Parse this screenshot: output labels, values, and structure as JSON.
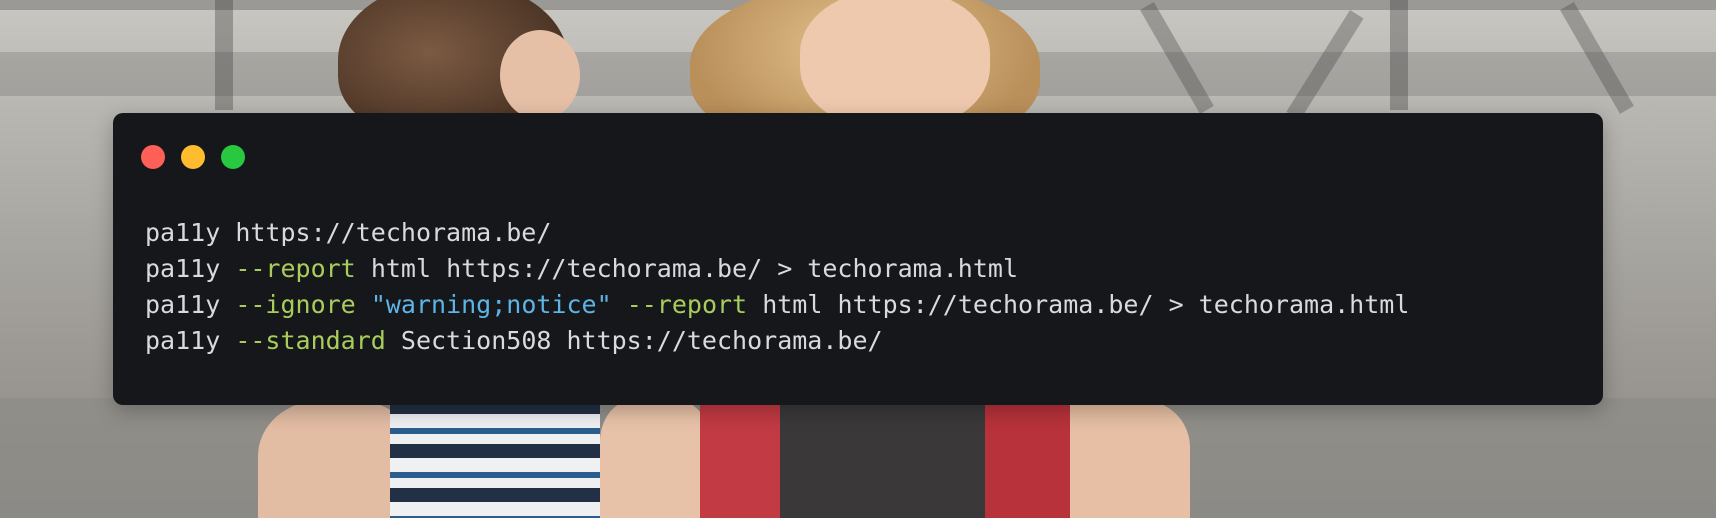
{
  "window": {
    "controls": [
      {
        "name": "close",
        "color": "#fe5f57"
      },
      {
        "name": "minimize",
        "color": "#febc2e"
      },
      {
        "name": "maximize",
        "color": "#28c840"
      }
    ]
  },
  "colors": {
    "terminal_bg": "#15171a",
    "text": "#d8dadc",
    "flag": "#a9cd5a",
    "string": "#5db4e6"
  },
  "code": {
    "lines": [
      {
        "cmd": "pa11y",
        "t1": "https://techorama.be/"
      },
      {
        "cmd": "pa11y",
        "flag1": "--report",
        "t1": "html https://techorama.be/ > techorama.html"
      },
      {
        "cmd": "pa11y",
        "flag1": "--ignore",
        "str1": "\"warning;notice\"",
        "flag2": "--report",
        "t1": "html https://techorama.be/ > techorama.html"
      },
      {
        "cmd": "pa11y",
        "flag1": "--standard",
        "t1": "Section508 https://techorama.be/"
      }
    ]
  }
}
